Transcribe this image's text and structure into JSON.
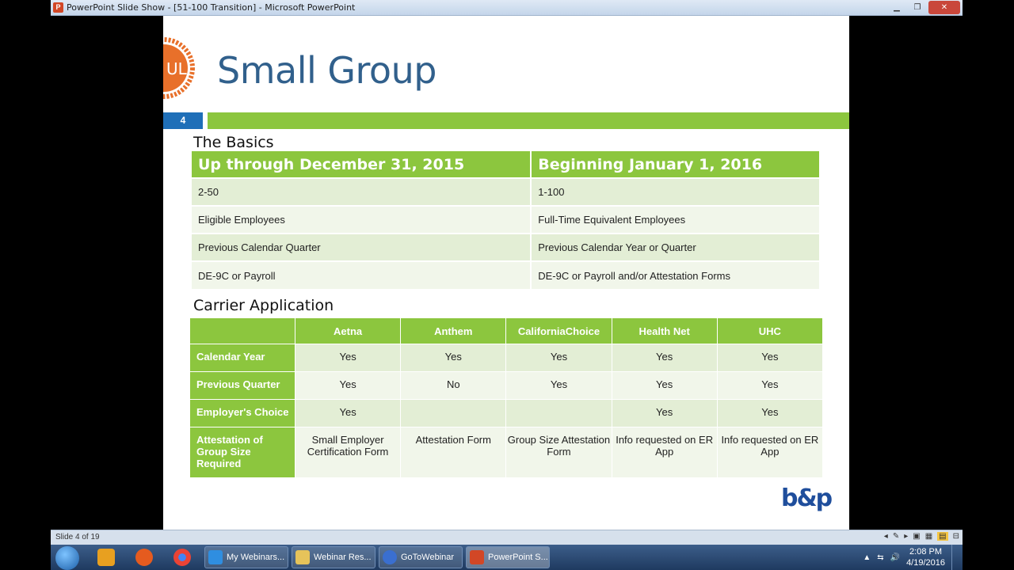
{
  "window": {
    "title": "PowerPoint Slide Show - [51-100 Transition] - Microsoft PowerPoint"
  },
  "slide": {
    "title": "Small Group",
    "number": "4",
    "logo_text": "UL",
    "basics_label": "The Basics",
    "basics": {
      "headers": [
        "Up through December 31, 2015",
        "Beginning January 1, 2016"
      ],
      "rows": [
        [
          "2-50",
          "1-100"
        ],
        [
          "Eligible Employees",
          "Full-Time Equivalent Employees"
        ],
        [
          "Previous Calendar Quarter",
          "Previous Calendar Year or Quarter"
        ],
        [
          "DE-9C or Payroll",
          "DE-9C or Payroll and/or Attestation Forms"
        ]
      ]
    },
    "carrier_label": "Carrier Application",
    "carrier": {
      "headers": [
        "",
        "Aetna",
        "Anthem",
        "CaliforniaChoice",
        "Health Net",
        "UHC"
      ],
      "rows": [
        [
          "Calendar Year",
          "Yes",
          "Yes",
          "Yes",
          "Yes",
          "Yes"
        ],
        [
          "Previous Quarter",
          "Yes",
          "No",
          "Yes",
          "Yes",
          "Yes"
        ],
        [
          "Employer's Choice",
          "Yes",
          "",
          "",
          "Yes",
          "Yes"
        ],
        [
          "Attestation of Group Size Required",
          "Small Employer Certification Form",
          "Attestation Form",
          "Group Size Attestation Form",
          "Info requested on ER App",
          "Info requested on ER App"
        ]
      ]
    },
    "bp_logo": "b&p"
  },
  "statusbar": {
    "slide_info": "Slide 4 of 19"
  },
  "taskbar": {
    "tasks": [
      {
        "label": "My Webinars...",
        "icon": "ie-icon"
      },
      {
        "label": "Webinar Res...",
        "icon": "folder-icon"
      },
      {
        "label": "GoToWebinar",
        "icon": "gotowebinar-icon"
      },
      {
        "label": "PowerPoint S...",
        "icon": "powerpoint-icon"
      }
    ],
    "clock_time": "2:08 PM",
    "clock_date": "4/19/2016"
  },
  "colors": {
    "accent_green": "#8cc63e",
    "title_blue": "#31608c",
    "number_blue": "#1f6fb8"
  }
}
